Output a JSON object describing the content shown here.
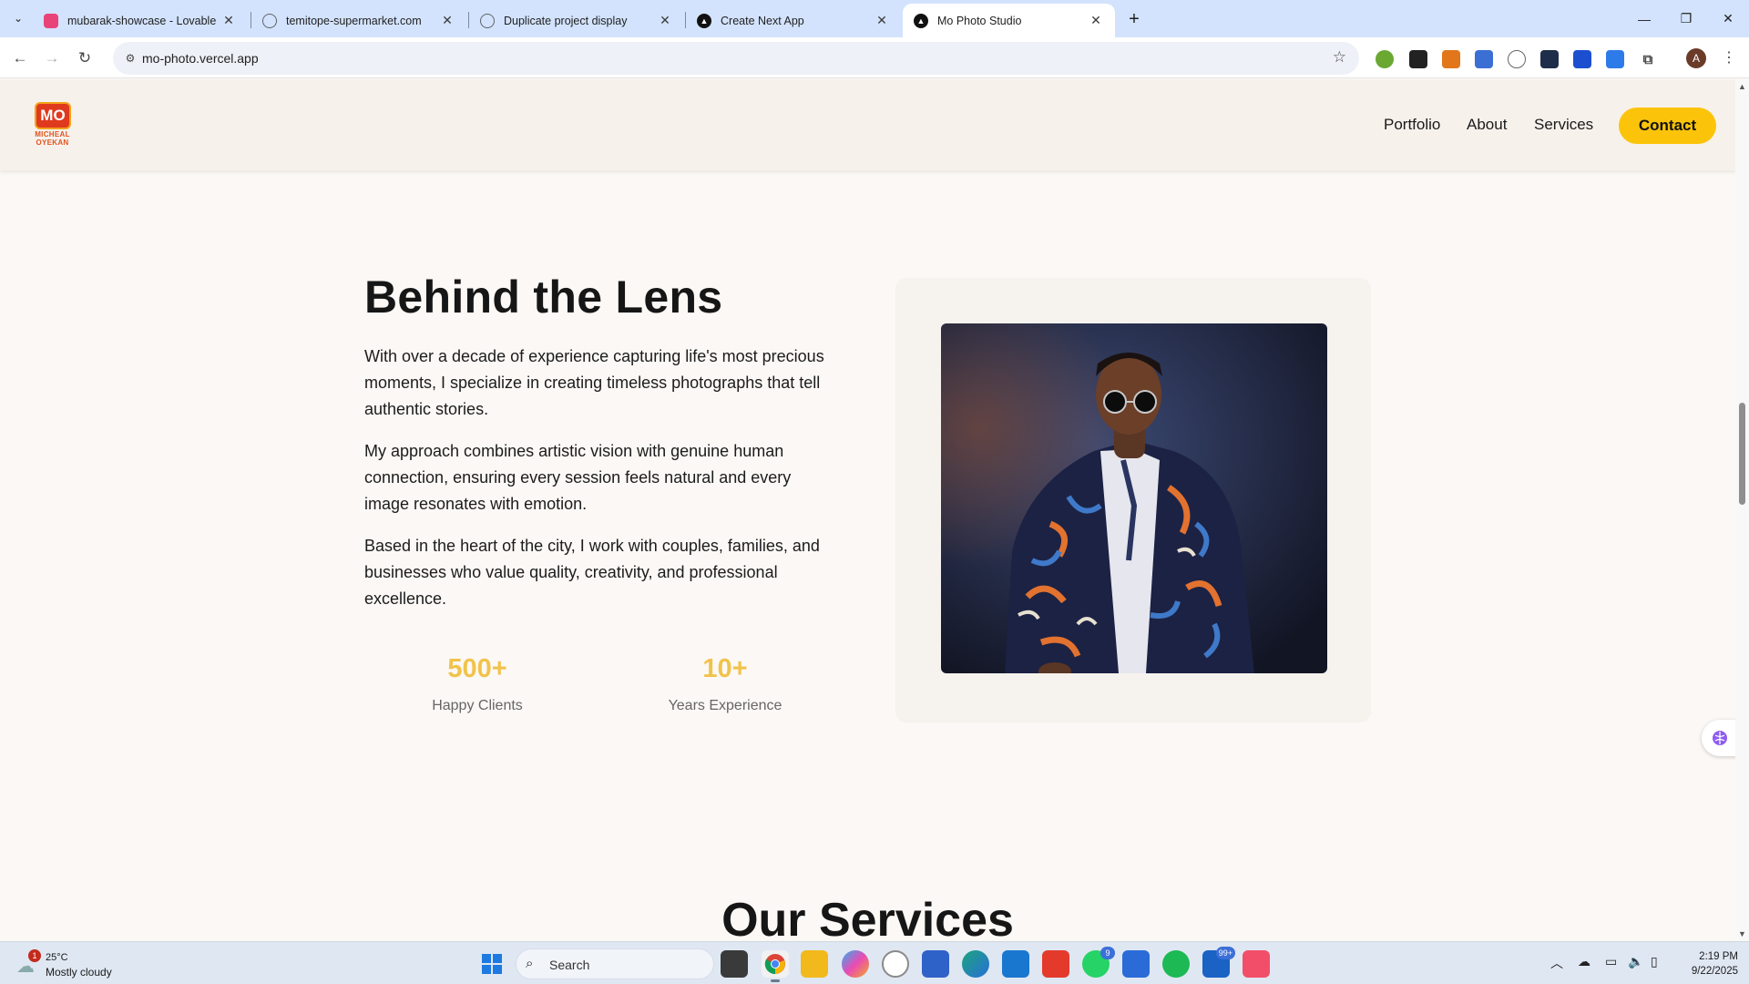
{
  "browser": {
    "tabs": [
      {
        "title": "mubarak-showcase - Lovable",
        "favicon": "lovable-heart-icon",
        "color": "#e9447a"
      },
      {
        "title": "temitope-supermarket.com",
        "favicon": "globe-icon",
        "color": "#5f6368"
      },
      {
        "title": "Duplicate project display",
        "favicon": "chatgpt-icon",
        "color": "#5f6368"
      },
      {
        "title": "Create Next App",
        "favicon": "vercel-icon",
        "color": "#111111"
      },
      {
        "title": "Mo Photo Studio",
        "favicon": "vercel-icon",
        "color": "#111111",
        "active": true
      }
    ],
    "url": "mo-photo.vercel.app"
  },
  "site": {
    "logo": {
      "mark": "MO",
      "text": "MICHEAL OYEKAN"
    },
    "nav": [
      {
        "label": "Portfolio"
      },
      {
        "label": "About"
      },
      {
        "label": "Services"
      }
    ],
    "contact_label": "Contact",
    "accent_color": "#fbc40a"
  },
  "about": {
    "title": "Behind the Lens",
    "paragraphs": [
      "With over a decade of experience capturing life's most precious moments, I specialize in creating timeless photographs that tell authentic stories.",
      "My approach combines artistic vision with genuine human connection, ensuring every session feels natural and every image resonates with emotion.",
      "Based in the heart of the city, I work with couples, families, and businesses who value quality, creativity, and professional excellence."
    ],
    "stats": [
      {
        "value": "500+",
        "label": "Happy Clients"
      },
      {
        "value": "10+",
        "label": "Years Experience"
      }
    ]
  },
  "services": {
    "title": "Our Services"
  },
  "taskbar": {
    "weather": {
      "temp": "25°C",
      "desc": "Mostly cloudy",
      "badge": "1"
    },
    "search_label": "Search",
    "badges": {
      "whatsapp": "9",
      "mail": "99+"
    },
    "time": "2:19 PM",
    "date": "9/22/2025"
  }
}
